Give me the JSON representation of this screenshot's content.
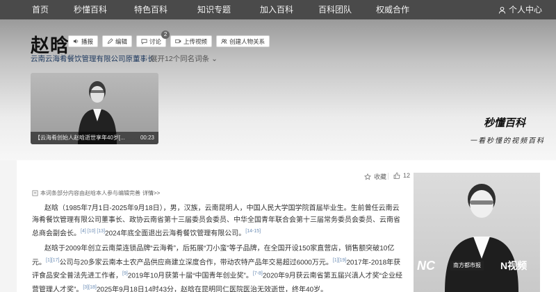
{
  "nav": {
    "items": [
      "首页",
      "秒懂百科",
      "特色百科",
      "知识专题",
      "加入百科",
      "百科团队",
      "权威合作"
    ],
    "user": "个人中心"
  },
  "entry": {
    "title": "赵晗",
    "actions": {
      "report": "播报",
      "edit": "编辑",
      "discuss": "讨论",
      "discuss_count": "2",
      "upload": "上传视频",
      "relation": "创建人物关系"
    },
    "subtitle": "云南云海肴餐饮管理有限公司原董事长",
    "expand": "展开12个同名词条"
  },
  "video": {
    "caption": "【云海肴创始人赵晗逝世享年40岁[...",
    "duration": "00:23"
  },
  "brand": {
    "logo": "秒懂百科",
    "slogan": "一看秒懂的视频百科"
  },
  "article": {
    "collect": "收藏",
    "share_count": "12",
    "notice": "本词条部分内容由赵晗本人参与编辑完善",
    "notice_link": "详情>>",
    "para1": "赵晗（1985年7月1日-2025年9月18日），男，汉族，云南昆明人，中国人民大学国学院首届毕业生。生前曾任云南云海肴餐饮管理有限公司董事长、政协云南省第十三届委员会委员、中华全国青年联合会第十三届常务委员会委员、云南省总商会副会长。",
    "para1_refs": "[4] [10] [13]",
    "para1_tail": "2024年底全面退出云海肴餐饮管理有限公司。",
    "para1_ref2": "[14-15]",
    "para2_a": "赵晗于2009年创立云南菜连锁品牌“云海肴”，后拓展“刀小蛮”等子品牌，在全国开设150家直营店，销售额突破10亿元。",
    "ref_a": "[1]",
    "ref_b": "[17]",
    "para2_b": "公司与20多家云南本土农产品供应商建立深度合作，带动农特产品年交易超过6000万元。",
    "ref_c": "[1]",
    "ref_d": "[19]",
    "para2_c": "2017年-2018年获评食品安全普法先进工作者，",
    "ref_e": "[9]",
    "para2_d": "2019年10月获第十届“中国青年创业奖”。",
    "ref_f": "[7-8]",
    "para2_e": "2020年9月获云南省第五届兴滇人才奖“企业经营管理人才奖”。",
    "ref_g": "[3]",
    "ref_h": "[18]",
    "para2_f": "2025年9月18日14时43分，赵晗在昆明同仁医院医治无效逝世，终年40岁。"
  },
  "portrait": {
    "wm_left": "NC",
    "wm_mid": "南方都市报",
    "wm_right": "N视频"
  }
}
